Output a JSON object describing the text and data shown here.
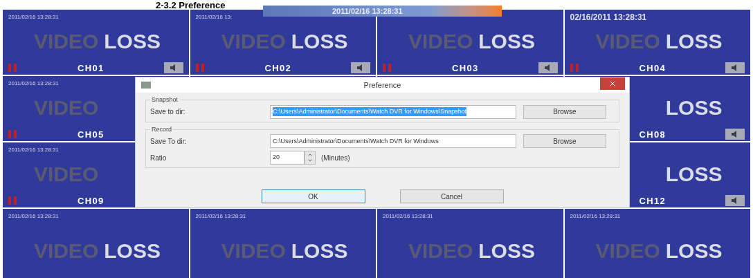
{
  "heading": "2-3.2 Preference",
  "overlay": {
    "text": "2011/02/16 13:28:31"
  },
  "rows": [
    {
      "tiles": [
        {
          "timestamp": "2011/02/16 13:28:31",
          "word1": "VIDEO",
          "word2": "LOSS",
          "channel": "CH01"
        },
        {
          "timestamp": "2011/02/16 13:",
          "word1": "VIDEO",
          "word2": "LOSS",
          "channel": "CH02"
        },
        {
          "word1": "VIDEO",
          "word2": "LOSS",
          "channel": "CH03"
        },
        {
          "timestamp": "02/16/2011 13:28:31",
          "big": true,
          "word1": "VIDEO",
          "word2": "LOSS",
          "channel": "CH04"
        }
      ]
    },
    {
      "left": {
        "timestamp": "2011/02/16 13:28:31",
        "word1": "VIDEO",
        "channel": "CH05"
      },
      "right": {
        "word2": "LOSS",
        "channel": "CH08"
      }
    },
    {
      "left": {
        "timestamp": "2011/02/16 13:28:31",
        "word1": "VIDEO",
        "channel": "CH09"
      },
      "right": {
        "word2": "LOSS",
        "channel": "CH12"
      }
    },
    {
      "tiles": [
        {
          "timestamp": "2011/02/16 13:28:31",
          "word1": "VIDEO",
          "word2": "LOSS"
        },
        {
          "timestamp": "2011/02/16 13:28:31",
          "word1": "VIDEO",
          "word2": "LOSS"
        },
        {
          "timestamp": "2011/02/16 13:28:31",
          "word1": "VIDEO",
          "word2": "LOSS"
        },
        {
          "timestamp": "2011/02/16 13:28:31",
          "word1": "VIDEO",
          "word2": "LOSS"
        }
      ]
    }
  ],
  "dialog": {
    "title": "Preference",
    "groups": [
      {
        "legend": "Snapshot",
        "rows": [
          {
            "kind": "path",
            "label": "Save to dir:",
            "value": "C:\\Users\\Administrator\\Documents\\Watch DVR for Windows\\Snapshot",
            "highlighted": true,
            "button": "Browse"
          }
        ]
      },
      {
        "legend": "Record",
        "rows": [
          {
            "kind": "path",
            "label": "Save To dir:",
            "value": "C:\\Users\\Administrator\\Documents\\Watch DVR for Windows",
            "highlighted": false,
            "button": "Browse"
          },
          {
            "kind": "spin",
            "label": "Ratio",
            "value": "20",
            "unit": "(Minutes)"
          }
        ]
      }
    ],
    "buttons": [
      {
        "label": "OK",
        "default": true
      },
      {
        "label": "Cancel",
        "default": false
      }
    ]
  }
}
